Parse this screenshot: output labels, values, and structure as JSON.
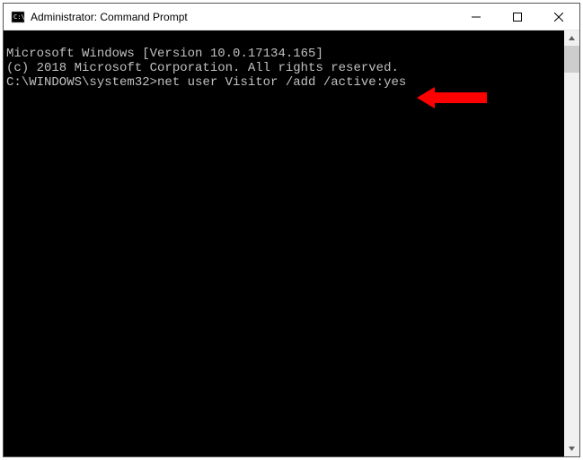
{
  "window": {
    "title": "Administrator: Command Prompt"
  },
  "console": {
    "line1": "Microsoft Windows [Version 10.0.17134.165]",
    "line2": "(c) 2018 Microsoft Corporation. All rights reserved.",
    "blank": "",
    "prompt": "C:\\WINDOWS\\system32>",
    "command": "net user Visitor /add /active:yes"
  },
  "annotation": {
    "arrow_color": "#ff0000"
  }
}
